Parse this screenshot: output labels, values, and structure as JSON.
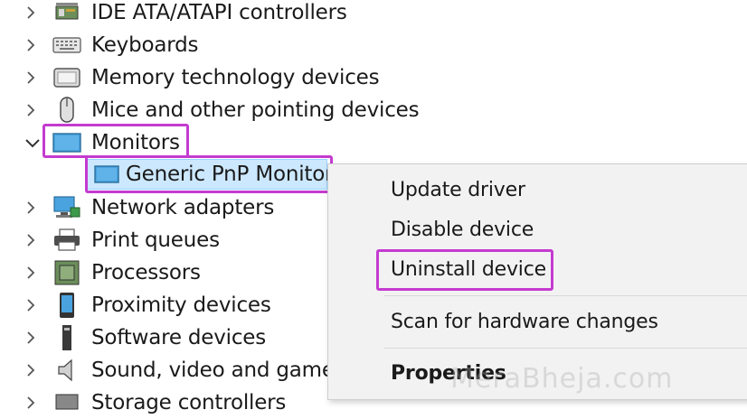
{
  "tree": {
    "items": [
      {
        "label": "IDE ATA/ATAPI controllers",
        "icon": "ide-controller-icon",
        "expanded": false
      },
      {
        "label": "Keyboards",
        "icon": "keyboard-icon",
        "expanded": false
      },
      {
        "label": "Memory technology devices",
        "icon": "memory-device-icon",
        "expanded": false
      },
      {
        "label": "Mice and other pointing devices",
        "icon": "mouse-icon",
        "expanded": false
      },
      {
        "label": "Monitors",
        "icon": "monitor-icon",
        "expanded": true
      },
      {
        "label": "Generic PnP Monitor",
        "icon": "monitor-icon",
        "child": true
      },
      {
        "label": "Network adapters",
        "icon": "network-adapter-icon",
        "expanded": false
      },
      {
        "label": "Print queues",
        "icon": "printer-icon",
        "expanded": false
      },
      {
        "label": "Processors",
        "icon": "processor-icon",
        "expanded": false
      },
      {
        "label": "Proximity devices",
        "icon": "proximity-device-icon",
        "expanded": false
      },
      {
        "label": "Software devices",
        "icon": "software-device-icon",
        "expanded": false
      },
      {
        "label": "Sound, video and game c",
        "icon": "speaker-icon",
        "expanded": false
      },
      {
        "label": "Storage controllers",
        "icon": "storage-controller-icon",
        "expanded": false
      }
    ]
  },
  "context_menu": {
    "items": [
      {
        "label": "Update driver"
      },
      {
        "label": "Disable device"
      },
      {
        "label": "Uninstall device"
      },
      {
        "label": "Scan for hardware changes"
      },
      {
        "label": "Properties",
        "bold": true
      }
    ]
  },
  "colors": {
    "highlight": "#c43bd0",
    "selection": "#cce8ff",
    "monitor_blue": "#4aa3df"
  },
  "watermark": "MeraBheja.com"
}
